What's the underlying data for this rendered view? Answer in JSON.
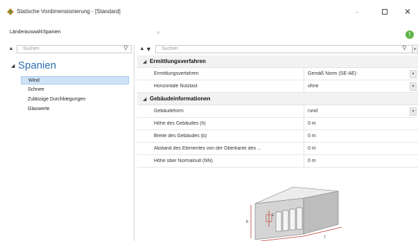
{
  "window": {
    "title": "Statische Vordimensionierung - [Standard]",
    "minimize_glyph": "–",
    "close_glyph": "✕"
  },
  "menu": {
    "items": [
      "Länderauswahl",
      "Spanien"
    ],
    "toolbar_chevron": "»",
    "info_glyph": "!"
  },
  "left_panel": {
    "search_placeholder": "Suchen",
    "collapse_glyph": "▲",
    "search_glyph": "⚲",
    "tree": {
      "root_arrow": "◢",
      "root_label": "Spanien",
      "items": [
        {
          "label": "Wind",
          "selected": true
        },
        {
          "label": "Schnee",
          "selected": false
        },
        {
          "label": "Zulässige Durchbiegungen",
          "selected": false
        },
        {
          "label": "Glaswerte",
          "selected": false
        }
      ]
    }
  },
  "right_panel": {
    "search_placeholder": "Suchen",
    "collapse_glyph": "▲",
    "filter_glyph": "▼",
    "search_glyph": "⚲",
    "scroll_glyph": "▸",
    "section_arrow": "◢",
    "dropdown_glyph": "▾",
    "sections": [
      {
        "title": "Ermittlungsverfahren",
        "rows": [
          {
            "name": "Ermittlungsverfahren",
            "value": "Gemäß Norm (SE-AE)",
            "dropdown": true
          },
          {
            "name": "Horizontale Nutzlast",
            "value": "ohne",
            "dropdown": true
          }
        ]
      },
      {
        "title": "Gebäudeinformationen",
        "rows": [
          {
            "name": "Gebäudeform",
            "value": "rund",
            "dropdown": true
          },
          {
            "name": "Höhe des Gebäudes (h)",
            "value": "0 m",
            "dropdown": false
          },
          {
            "name": "Breite des Gebäudes (b)",
            "value": "0 m",
            "dropdown": false
          },
          {
            "name": "Abstand des Elementes von der Oberkante des ...",
            "value": "0 m",
            "dropdown": false
          },
          {
            "name": "Höhe über Normalnull (NN)",
            "value": "0 m",
            "dropdown": false
          }
        ]
      }
    ],
    "illustration": {
      "labels": {
        "h": "h",
        "b": "b",
        "t": "t",
        "z": "z"
      }
    }
  },
  "colors": {
    "accent": "#2a6fb0",
    "selection": "#cfe3f7",
    "info_green": "#5fb548",
    "section_bg": "#f2f2f2"
  }
}
